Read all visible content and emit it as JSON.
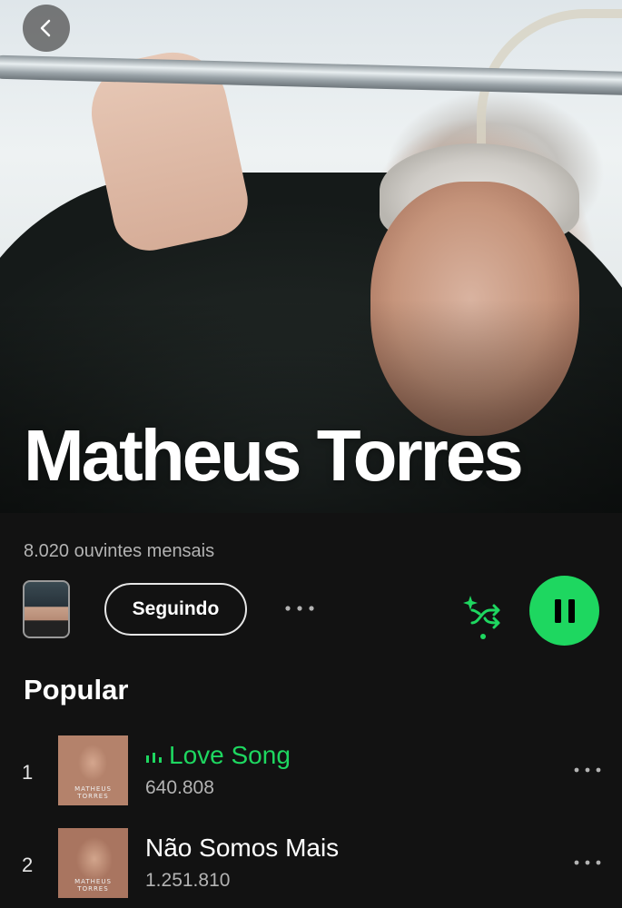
{
  "header": {
    "back_icon": "chevron-left-icon"
  },
  "artist": {
    "name": "Matheus Torres",
    "monthly_listeners": "8.020 ouvintes mensais"
  },
  "actions": {
    "follow_label": "Seguindo",
    "more_icon": "more-horizontal-icon",
    "shuffle_icon": "smart-shuffle-icon",
    "play_state_icon": "pause-icon",
    "accent_color": "#1ed760"
  },
  "popular": {
    "title": "Popular",
    "tracks": [
      {
        "rank": "1",
        "title": "Love Song",
        "plays": "640.808",
        "playing": true,
        "cover_text": "MATHEUS TORRES"
      },
      {
        "rank": "2",
        "title": "Não Somos Mais",
        "plays": "1.251.810",
        "playing": false,
        "cover_text": "MATHEUS TORRES"
      }
    ]
  }
}
